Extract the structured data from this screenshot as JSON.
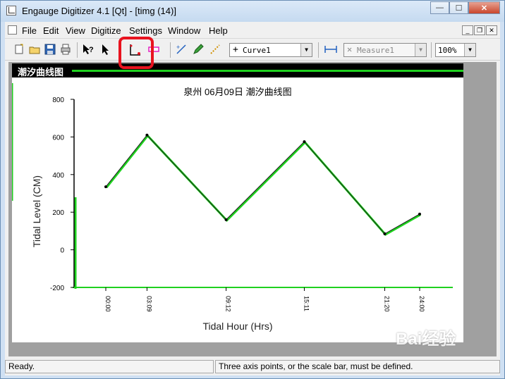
{
  "window": {
    "title": "Engauge Digitizer 4.1 [Qt] - [timg (14)]",
    "minimize_glyph": "—",
    "maximize_glyph": "☐",
    "close_glyph": "✕"
  },
  "menubar": {
    "items": [
      "File",
      "Edit",
      "View",
      "Digitize",
      "Settings",
      "Window",
      "Help"
    ],
    "mdi_minimize": "_",
    "mdi_restore": "❐",
    "mdi_close": "✕"
  },
  "toolbar": {
    "curve_combo_value": "Curve1",
    "measure_combo_value": "Measure1",
    "zoom_combo_value": "100%",
    "icons": [
      "new-document-icon",
      "open-folder-icon",
      "save-icon",
      "print-icon",
      "whats-this-icon",
      "select-arrow-icon",
      "axis-point-icon",
      "scale-bar-icon",
      "curve-point-icon",
      "pencil-icon",
      "segment-fill-icon",
      "measure-icon"
    ],
    "highlight_color": "#e8131f"
  },
  "image": {
    "band_title": "潮汐曲线图",
    "accent_green": "#1fd11f"
  },
  "chart_data": {
    "type": "line",
    "title": "泉州 06月09日 潮汐曲线图",
    "xlabel": "Tidal Hour (Hrs)",
    "ylabel": "Tidal Level (CM)",
    "categories": [
      "00:00",
      "03:09",
      "09:12",
      "15:11",
      "21:20",
      "24:00"
    ],
    "x": [
      0,
      3.15,
      9.2,
      15.18,
      21.33,
      24
    ],
    "values": [
      335,
      610,
      160,
      575,
      85,
      190
    ],
    "ylim": [
      -200,
      800
    ],
    "yticks": [
      -200,
      0,
      200,
      400,
      600,
      800
    ],
    "grid": false,
    "legend": "none"
  },
  "statusbar": {
    "left": "Ready.",
    "right": "Three axis points, or the scale bar, must be defined."
  },
  "watermark": "Bai经验"
}
